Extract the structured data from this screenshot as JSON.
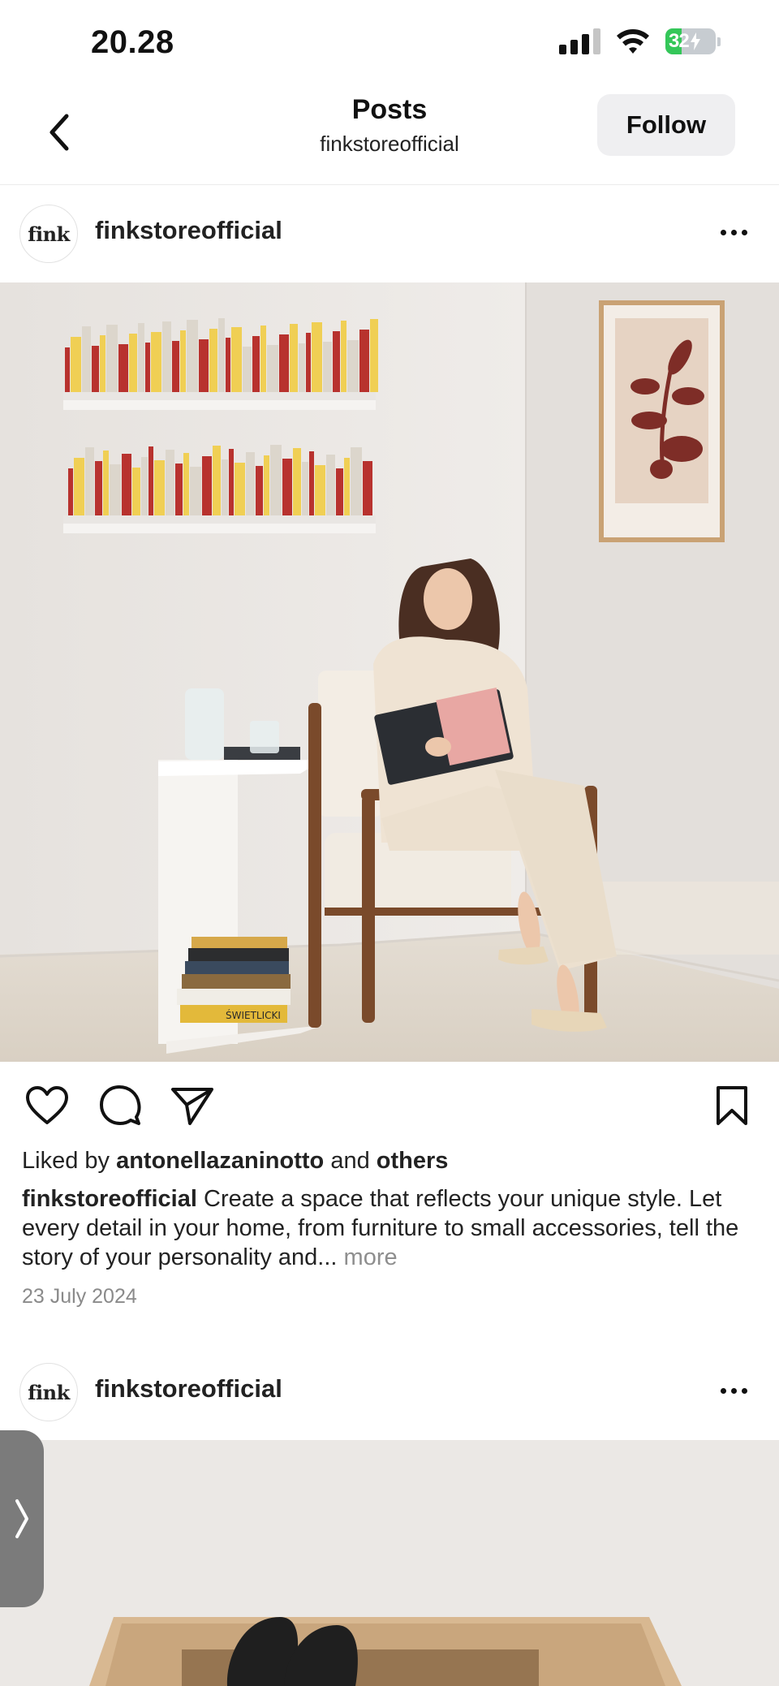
{
  "status_bar": {
    "time": "20.28",
    "battery_level": "32",
    "battery_fraction": 0.32,
    "signal_bars": 3,
    "colors": {
      "battery_fill": "#34c759"
    },
    "icons": [
      "signal-icon",
      "wifi-icon",
      "battery-icon"
    ]
  },
  "header": {
    "title": "Posts",
    "subtitle": "finkstoreofficial",
    "follow_label": "Follow",
    "back_icon": "chevron-left-icon"
  },
  "posts": [
    {
      "avatar_text": "fink",
      "username": "finkstoreofficial",
      "image_alt": "Woman reading a book in an armchair beside wall bookshelves",
      "liked_by_prefix": "Liked by",
      "liked_by_user": "antonellazaninotto",
      "liked_by_joiner": "and",
      "liked_by_others": "others",
      "caption_user": "finkstoreofficial",
      "caption_text": "Create a space that reflects your unique style. Let every detail in your home, from furniture to small accessories, tell the story of your personality and...",
      "caption_more": "more",
      "date": "23 July 2024",
      "book_spine_label": "ŚWIETLICKI"
    },
    {
      "avatar_text": "fink",
      "username": "finkstoreofficial"
    }
  ],
  "actions": {
    "icons": [
      "heart-icon",
      "comment-icon",
      "share-icon",
      "bookmark-icon"
    ]
  }
}
